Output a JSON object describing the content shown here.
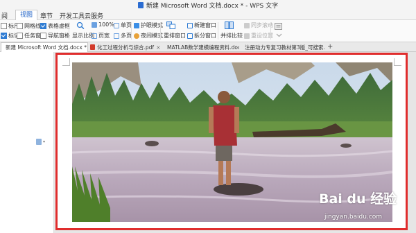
{
  "window": {
    "title": "新建 Microsoft Word 文档.docx * - WPS 文字"
  },
  "menu": {
    "items": [
      {
        "label": "阅",
        "active": false
      },
      {
        "label": "视图",
        "active": true
      },
      {
        "label": "章节",
        "active": false
      },
      {
        "label": "开发工具",
        "active": false
      },
      {
        "label": "云服务",
        "active": false
      }
    ]
  },
  "ribbon": {
    "checkboxes": [
      {
        "label": "标尺",
        "checked": false
      },
      {
        "label": "网格线",
        "checked": false
      },
      {
        "label": "表格虚框",
        "checked": true
      },
      {
        "label": "标记",
        "checked": true
      },
      {
        "label": "任务窗格",
        "checked": false
      },
      {
        "label": "导航窗格",
        "checked": false
      }
    ],
    "zoom_label": "显示比例",
    "zoom_percent": "100%",
    "single_page": "单页",
    "page_width": "页宽",
    "multi_page": "多页",
    "eye_mode": "护眼模式",
    "night_mode": "夜间模式",
    "rearrange_window": "重排窗口",
    "new_window": "新建窗口",
    "split_window": "拆分窗口",
    "side_by_side": "并排比较",
    "sync_scroll": "同步滚动",
    "reset_position": "重设位置"
  },
  "tabs": [
    {
      "label": "新建 Microsoft Word 文档.docx *",
      "active": true,
      "close": "×",
      "icon_color": "#2b6cd1"
    },
    {
      "label": "化工过程分析与综合.pdf",
      "active": false,
      "close": "×",
      "icon_color": "#d23b2b"
    },
    {
      "label": "MATLAB数学建模编程资料.doc",
      "active": false,
      "close": "×",
      "icon_color": "#2b6cd1"
    },
    {
      "label": "注册动力专复习教材第3版_可搜索.pdf",
      "active": false,
      "close": "×",
      "icon_color": "#d23b2b"
    }
  ],
  "new_tab": "+",
  "watermark": {
    "logo": "Bai du 经验",
    "url": "jingyan.baidu.com"
  },
  "colors": {
    "highlight_border": "#e02d2d",
    "active_menu": "#1b5fc5"
  }
}
